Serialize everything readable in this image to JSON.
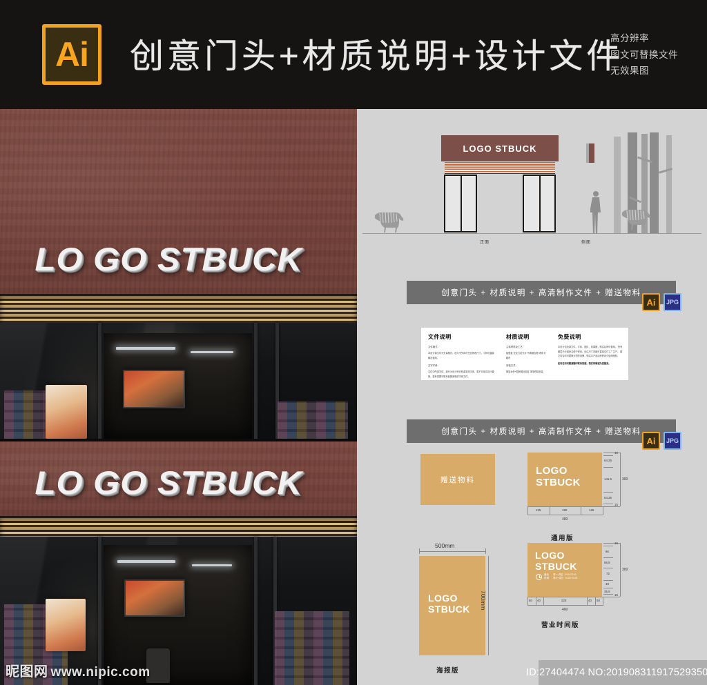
{
  "header": {
    "logo_badge": "Ai",
    "title": "创意门头+材质说明+设计文件",
    "notes": [
      "高分辨率",
      "图文可替换文件",
      "无效果图"
    ]
  },
  "photos": {
    "sign_text_top": "LO GO STBUCK",
    "sign_text_bottom": "LO GO STBUCK",
    "watermark_cn": "昵图网",
    "watermark_url": "www.nipic.com"
  },
  "elevation": {
    "sign_text": "LOGO  STBUCK",
    "label_front": "正面",
    "label_side": "侧面"
  },
  "banner": {
    "text": "创意门头 + 材质说明 + 高清制作文件 + 赠送物料",
    "format_ai": "Ai",
    "format_jpg": "JPG"
  },
  "info_card": {
    "columns": [
      {
        "heading": "文件说明",
        "blocks": [
          {
            "sub": "文件格式：",
            "body": "本设计源文件为矢量格式，放大不失真可任意修改尺寸，小样可直接输出使用。"
          },
          {
            "sub": "文字字体：",
            "body": "文件中所用字体，部分为设计师已转曲常用字体，若不可用请自行替换，若有需要可联系客服索取原字体文件。"
          }
        ]
      },
      {
        "heading": "材质说明",
        "blocks": [
          {
            "sub": "主体材质及工艺：",
            "body": "铝塑板  亚克力发光字  不锈钢边框\n烤漆  灯箱布"
          },
          {
            "sub": "安装方式：",
            "body": "钢架龙骨+膨胀螺丝固定\n现场焊接安装"
          }
        ]
      },
      {
        "heading": "免费说明",
        "blocks": [
          {
            "sub": "",
            "body": "本设计包含源文件、字体、图片、效果图，购买后即可使用。\n所有图层已分组命名便于修改，标注尺寸详细可直接交付工厂生产。\n图文内容均可替换为您的品牌，购买本产品后即获永久使用授权。"
          },
          {
            "sub": "",
            "body": "如有任何问题请随时联系客服，我们将竭诚为您服务。",
            "bold": true
          }
        ]
      }
    ]
  },
  "products": {
    "giveaway": {
      "label": "赠送物料"
    },
    "universal": {
      "logo_line1": "LOGO",
      "logo_line2": "STBUCK",
      "part_label": "通用版",
      "v_dims": [
        "15",
        "64.25",
        "141.5",
        "64.25",
        "15"
      ],
      "v_total": "300",
      "h_dims": [
        "125",
        "150",
        "125"
      ],
      "h_total": "400"
    },
    "poster": {
      "logo_line1": "LOGO",
      "logo_line2": "STBUCK",
      "part_label": "海报版",
      "width_label": "500mm",
      "height_label": "700mm"
    },
    "hours": {
      "logo_line1": "LOGO",
      "logo_line2": "STBUCK",
      "part_label": "营业时间版",
      "hours_title_1": "营业",
      "hours_title_2": "时间",
      "row1_days": "周一~周五",
      "row1_time": "9:00~22:00",
      "row2_days": "周六~周日",
      "row2_time": "10:00~23:00",
      "v_dims": [
        "15",
        "66",
        "56.5",
        "72",
        "40",
        "35.5",
        "15"
      ],
      "v_total": "300",
      "h_dims": [
        "50",
        "40",
        "220",
        "40",
        "50"
      ],
      "h_total": "400"
    }
  },
  "footer": {
    "id_text": "ID:27404474 NO:20190831191752935000"
  },
  "colors": {
    "accent_orange": "#f3a21e",
    "tan": "#d8ab68",
    "brick": "#7c4f49",
    "panel_bg": "#d3d3d3",
    "banner_grey": "#6e6e6e"
  }
}
